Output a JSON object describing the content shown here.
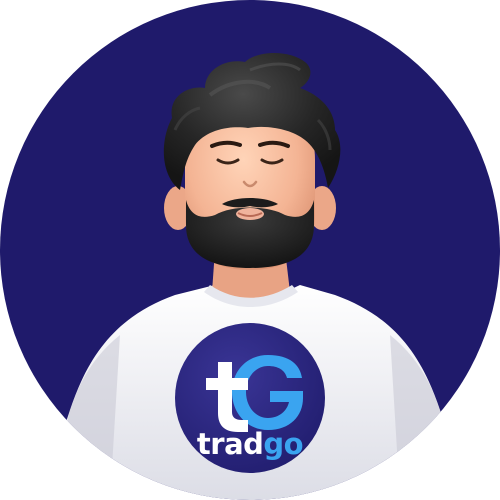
{
  "avatar": {
    "description_icon": "3d-bearded-man-avatar",
    "background_color": "#1f1a6b"
  },
  "logo": {
    "icon": "tradgo-logo-mark",
    "wordmark_part1": "trad",
    "wordmark_part2": "go",
    "badge_color": "#2a2580",
    "accent_color": "#3aa4f0"
  }
}
